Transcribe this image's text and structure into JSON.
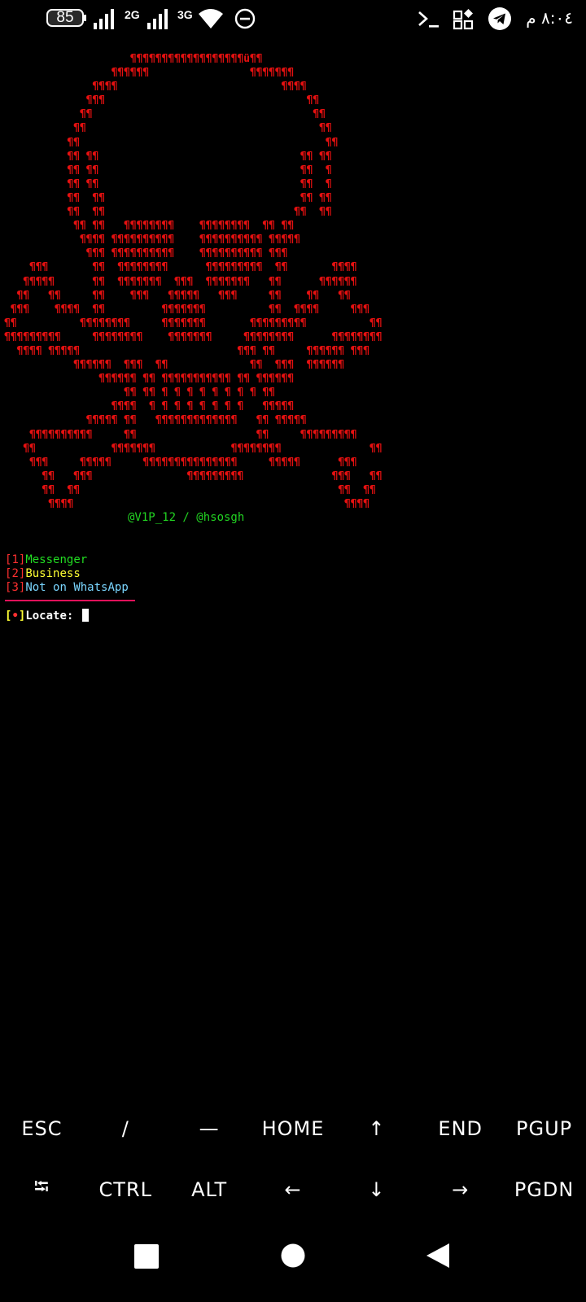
{
  "status_bar": {
    "battery": "85",
    "net1": "2G",
    "net2": "3G",
    "clock": "٨:٠٤ م",
    "icons": [
      "battery-icon",
      "signal-icon",
      "signal-icon",
      "wifi-icon",
      "do-not-disturb-icon",
      "terminal-icon",
      "apps-icon",
      "telegram-icon"
    ]
  },
  "terminal": {
    "art_lines": [
      "                    ¶¶¶¶¶¶¶¶¶¶¶¶¶¶¶¶¶¶ü¶¶",
      "                 ¶¶¶¶¶¶                ¶¶¶¶¶¶¶",
      "              ¶¶¶¶                          ¶¶¶¶",
      "             ¶¶¶                                ¶¶",
      "            ¶¶                                   ¶¶",
      "           ¶¶                                     ¶¶",
      "          ¶¶                                       ¶¶",
      "          ¶¶ ¶¶                                ¶¶ ¶¶",
      "          ¶¶ ¶¶                                ¶¶  ¶",
      "          ¶¶ ¶¶                                ¶¶  ¶",
      "          ¶¶  ¶¶                               ¶¶ ¶¶",
      "          ¶¶  ¶¶                              ¶¶  ¶¶",
      "           ¶¶ ¶¶   ¶¶¶¶¶¶¶¶    ¶¶¶¶¶¶¶¶  ¶¶ ¶¶",
      "            ¶¶¶¶ ¶¶¶¶¶¶¶¶¶¶    ¶¶¶¶¶¶¶¶¶¶ ¶¶¶¶¶",
      "             ¶¶¶ ¶¶¶¶¶¶¶¶¶¶    ¶¶¶¶¶¶¶¶¶¶ ¶¶¶",
      "    ¶¶¶       ¶¶  ¶¶¶¶¶¶¶¶      ¶¶¶¶¶¶¶¶¶  ¶¶       ¶¶¶¶",
      "   ¶¶¶¶¶      ¶¶  ¶¶¶¶¶¶¶  ¶¶¶  ¶¶¶¶¶¶¶   ¶¶      ¶¶¶¶¶¶",
      "  ¶¶   ¶¶     ¶¶    ¶¶¶   ¶¶¶¶¶   ¶¶¶     ¶¶    ¶¶   ¶¶",
      " ¶¶¶    ¶¶¶¶  ¶¶         ¶¶¶¶¶¶¶          ¶¶  ¶¶¶¶     ¶¶¶",
      "¶¶          ¶¶¶¶¶¶¶¶     ¶¶¶¶¶¶¶       ¶¶¶¶¶¶¶¶¶          ¶¶",
      "¶¶¶¶¶¶¶¶¶     ¶¶¶¶¶¶¶¶    ¶¶¶¶¶¶¶     ¶¶¶¶¶¶¶¶      ¶¶¶¶¶¶¶¶",
      "  ¶¶¶¶ ¶¶¶¶¶                         ¶¶¶ ¶¶     ¶¶¶¶¶¶ ¶¶¶",
      "           ¶¶¶¶¶¶  ¶¶¶  ¶¶             ¶¶  ¶¶¶  ¶¶¶¶¶¶",
      "               ¶¶¶¶¶¶ ¶¶ ¶¶¶¶¶¶¶¶¶¶¶ ¶¶ ¶¶¶¶¶¶",
      "                   ¶¶ ¶¶ ¶ ¶ ¶ ¶ ¶ ¶ ¶ ¶ ¶¶",
      "                 ¶¶¶¶  ¶ ¶ ¶ ¶ ¶ ¶ ¶ ¶   ¶¶¶¶¶",
      "             ¶¶¶¶¶ ¶¶   ¶¶¶¶¶¶¶¶¶¶¶¶¶   ¶¶ ¶¶¶¶¶",
      "    ¶¶¶¶¶¶¶¶¶¶     ¶¶                   ¶¶     ¶¶¶¶¶¶¶¶¶",
      "   ¶¶            ¶¶¶¶¶¶¶            ¶¶¶¶¶¶¶¶              ¶¶",
      "    ¶¶¶     ¶¶¶¶¶     ¶¶¶¶¶¶¶¶¶¶¶¶¶¶¶     ¶¶¶¶¶      ¶¶¶",
      "      ¶¶   ¶¶¶               ¶¶¶¶¶¶¶¶¶              ¶¶¶   ¶¶",
      "      ¶¶  ¶¶                                         ¶¶  ¶¶",
      "       ¶¶¶¶                                           ¶¶¶¶"
    ],
    "credit": "@V1P_12 / @hsosgh",
    "options": [
      {
        "num": "1",
        "label": "Messenger"
      },
      {
        "num": "2",
        "label": "Business"
      },
      {
        "num": "3",
        "label": "Not on WhatsApp"
      }
    ],
    "prompt_bullet": "•",
    "prompt_label": "Locate: "
  },
  "extra_keys": {
    "row1": [
      "ESC",
      "/",
      "—",
      "HOME",
      "↑",
      "END",
      "PGUP"
    ],
    "row2": [
      "⭾",
      "CTRL",
      "ALT",
      "←",
      "↓",
      "→",
      "PGDN"
    ]
  },
  "nav_icons": [
    "recents-square-icon",
    "home-circle-icon",
    "back-triangle-icon"
  ]
}
